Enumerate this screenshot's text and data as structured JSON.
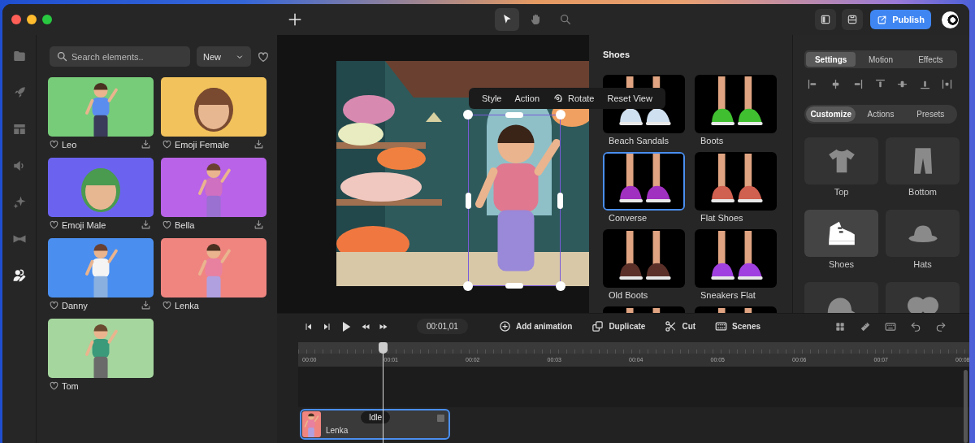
{
  "toolbar": {
    "tools": [
      {
        "kind": "pointer",
        "selected": true
      },
      {
        "kind": "hand",
        "selected": false
      },
      {
        "kind": "zoom",
        "selected": false
      }
    ],
    "publish": "Publish"
  },
  "rail": [
    {
      "kind": "folder",
      "selected": false
    },
    {
      "kind": "rocket",
      "selected": false
    },
    {
      "kind": "layout",
      "selected": false
    },
    {
      "kind": "sound",
      "selected": false
    },
    {
      "kind": "sparkle",
      "selected": false
    },
    {
      "kind": "bowtie",
      "selected": false
    },
    {
      "kind": "people",
      "selected": true
    }
  ],
  "library": {
    "search": {
      "placeholder": "Search elements.."
    },
    "sort": "New",
    "items": [
      {
        "name": "Leo",
        "color": "#77cc7a",
        "download": true
      },
      {
        "name": "Emoji Female",
        "color": "#f2c25c",
        "download": true
      },
      {
        "name": "Emoji Male",
        "color": "#6b63f0",
        "download": true
      },
      {
        "name": "Bella",
        "color": "#b863e8",
        "download": true
      },
      {
        "name": "Danny",
        "color": "#4a8ff0",
        "download": true
      },
      {
        "name": "Lenka",
        "color": "#f08580",
        "download": false
      },
      {
        "name": "Tom",
        "color": "#a5d69e",
        "download": false
      }
    ]
  },
  "canvas": {
    "menu": [
      {
        "label": "Style"
      },
      {
        "label": "Action"
      },
      {
        "label": "Rotate",
        "kind": "rotate"
      },
      {
        "label": "Reset View"
      }
    ]
  },
  "shoes": {
    "title": "Shoes",
    "items": [
      {
        "name": "Beach Sandals",
        "selected": false
      },
      {
        "name": "Boots",
        "selected": false
      },
      {
        "name": "Converse",
        "selected": true
      },
      {
        "name": "Flat Shoes",
        "selected": false
      },
      {
        "name": "Old Boots",
        "selected": false
      },
      {
        "name": "Sneakers Flat",
        "selected": false
      },
      {
        "selected": false
      },
      {
        "selected": false
      }
    ]
  },
  "inspector": {
    "tabs": [
      {
        "label": "Settings",
        "selected": true
      },
      {
        "label": "Motion",
        "selected": false
      },
      {
        "label": "Effects",
        "selected": false
      }
    ],
    "align": [
      {
        "kind": "left"
      },
      {
        "kind": "center"
      },
      {
        "kind": "right"
      },
      {
        "kind": "top"
      },
      {
        "kind": "middle"
      },
      {
        "kind": "bottom"
      },
      {
        "kind": "distribute"
      }
    ],
    "subtabs": [
      {
        "label": "Customize",
        "selected": true
      },
      {
        "label": "Actions",
        "selected": false
      },
      {
        "label": "Presets",
        "selected": false
      }
    ],
    "categories": [
      {
        "label": "Top",
        "kind": "shirt",
        "selected": false
      },
      {
        "label": "Bottom",
        "kind": "pants",
        "selected": false
      },
      {
        "label": "Shoes",
        "kind": "shoe",
        "selected": true
      },
      {
        "label": "Hats",
        "kind": "hat",
        "selected": false
      },
      {
        "kind": "cap",
        "selected": false
      },
      {
        "kind": "glasses",
        "selected": false
      }
    ]
  },
  "timeline": {
    "transport": [
      {
        "kind": "skip-start"
      },
      {
        "kind": "skip-end"
      },
      {
        "kind": "play"
      },
      {
        "kind": "rewind"
      },
      {
        "kind": "forward"
      }
    ],
    "time": "00:01,01",
    "actions": [
      {
        "kind": "add",
        "label": "Add animation"
      },
      {
        "kind": "duplicate",
        "label": "Duplicate"
      },
      {
        "kind": "cut",
        "label": "Cut"
      },
      {
        "kind": "scenes",
        "label": "Scenes"
      }
    ],
    "tools": [
      {
        "kind": "grid"
      },
      {
        "kind": "ruler"
      },
      {
        "kind": "keyboard"
      },
      {
        "kind": "undo"
      },
      {
        "kind": "redo"
      }
    ],
    "ticks": [
      "00:00",
      "00:01",
      "00:02",
      "00:03",
      "00:04",
      "00:05",
      "00:06",
      "00:07",
      "00:08"
    ],
    "playhead": {
      "level": 0.126
    },
    "clip": {
      "name": "Lenka",
      "tag": "Idle",
      "selected": true
    }
  }
}
